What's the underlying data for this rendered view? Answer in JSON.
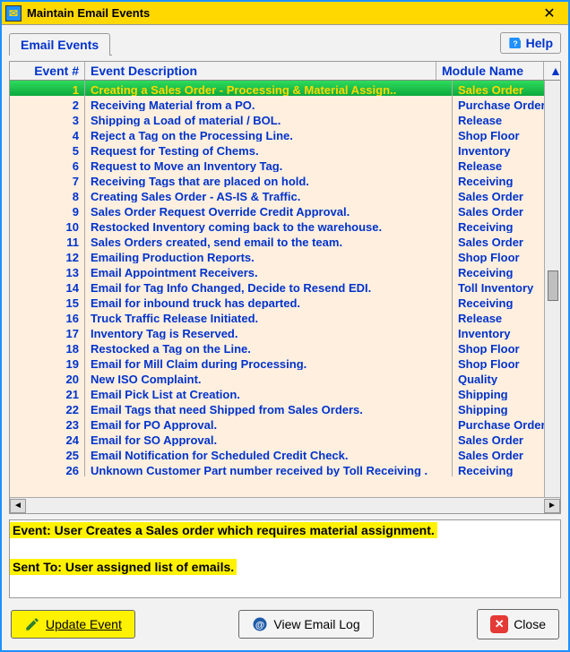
{
  "window": {
    "title": "Maintain Email Events"
  },
  "tabs": {
    "label": "Email Events"
  },
  "help": {
    "label": "Help"
  },
  "columns": {
    "num": "Event #",
    "desc": "Event Description",
    "mod": "Module Name"
  },
  "rows": [
    {
      "n": "1",
      "desc": "Creating a Sales Order - Processing & Material Assign..",
      "mod": "Sales Order",
      "sel": true
    },
    {
      "n": "2",
      "desc": "Receiving Material from a PO.",
      "mod": "Purchase Order"
    },
    {
      "n": "3",
      "desc": "Shipping a Load of material / BOL.",
      "mod": "Release"
    },
    {
      "n": "4",
      "desc": "Reject a Tag on the Processing Line.",
      "mod": "Shop Floor"
    },
    {
      "n": "5",
      "desc": "Request for Testing of Chems.",
      "mod": "Inventory"
    },
    {
      "n": "6",
      "desc": "Request to Move an Inventory Tag.",
      "mod": "Release"
    },
    {
      "n": "7",
      "desc": "Receiving Tags that are placed on hold.",
      "mod": "Receiving"
    },
    {
      "n": "8",
      "desc": "Creating Sales Order - AS-IS & Traffic.",
      "mod": "Sales Order"
    },
    {
      "n": "9",
      "desc": "Sales Order Request Override Credit Approval.",
      "mod": "Sales Order"
    },
    {
      "n": "10",
      "desc": "Restocked Inventory coming back to the warehouse.",
      "mod": "Receiving"
    },
    {
      "n": "11",
      "desc": "Sales Orders created, send email to the team.",
      "mod": "Sales Order"
    },
    {
      "n": "12",
      "desc": "Emailing Production Reports.",
      "mod": "Shop Floor"
    },
    {
      "n": "13",
      "desc": "Email Appointment Receivers.",
      "mod": "Receiving"
    },
    {
      "n": "14",
      "desc": "Email for Tag Info Changed, Decide to Resend EDI.",
      "mod": "Toll Inventory"
    },
    {
      "n": "15",
      "desc": "Email for inbound truck has departed.",
      "mod": "Receiving"
    },
    {
      "n": "16",
      "desc": "Truck Traffic Release Initiated.",
      "mod": "Release"
    },
    {
      "n": "17",
      "desc": "Inventory Tag is Reserved.",
      "mod": "Inventory"
    },
    {
      "n": "18",
      "desc": "Restocked a Tag on the Line.",
      "mod": "Shop Floor"
    },
    {
      "n": "19",
      "desc": "Email for Mill Claim during Processing.",
      "mod": "Shop Floor"
    },
    {
      "n": "20",
      "desc": "New ISO Complaint.",
      "mod": "Quality"
    },
    {
      "n": "21",
      "desc": "Email Pick List at Creation.",
      "mod": "Shipping"
    },
    {
      "n": "22",
      "desc": "Email Tags that need Shipped from Sales Orders.",
      "mod": "Shipping"
    },
    {
      "n": "23",
      "desc": "Email for PO Approval.",
      "mod": "Purchase Order"
    },
    {
      "n": "24",
      "desc": "Email for SO Approval.",
      "mod": "Sales Order"
    },
    {
      "n": "25",
      "desc": "Email Notification for Scheduled Credit Check.",
      "mod": "Sales Order"
    },
    {
      "n": "26",
      "desc": "Unknown Customer Part number received by Toll Receiving .",
      "mod": "Receiving"
    }
  ],
  "detail": {
    "line1": "Event: User Creates a Sales order which requires material assignment.",
    "line2": "Sent To: User assigned list of emails."
  },
  "buttons": {
    "update": "Update Event",
    "viewlog": "View Email Log",
    "close": "Close"
  }
}
